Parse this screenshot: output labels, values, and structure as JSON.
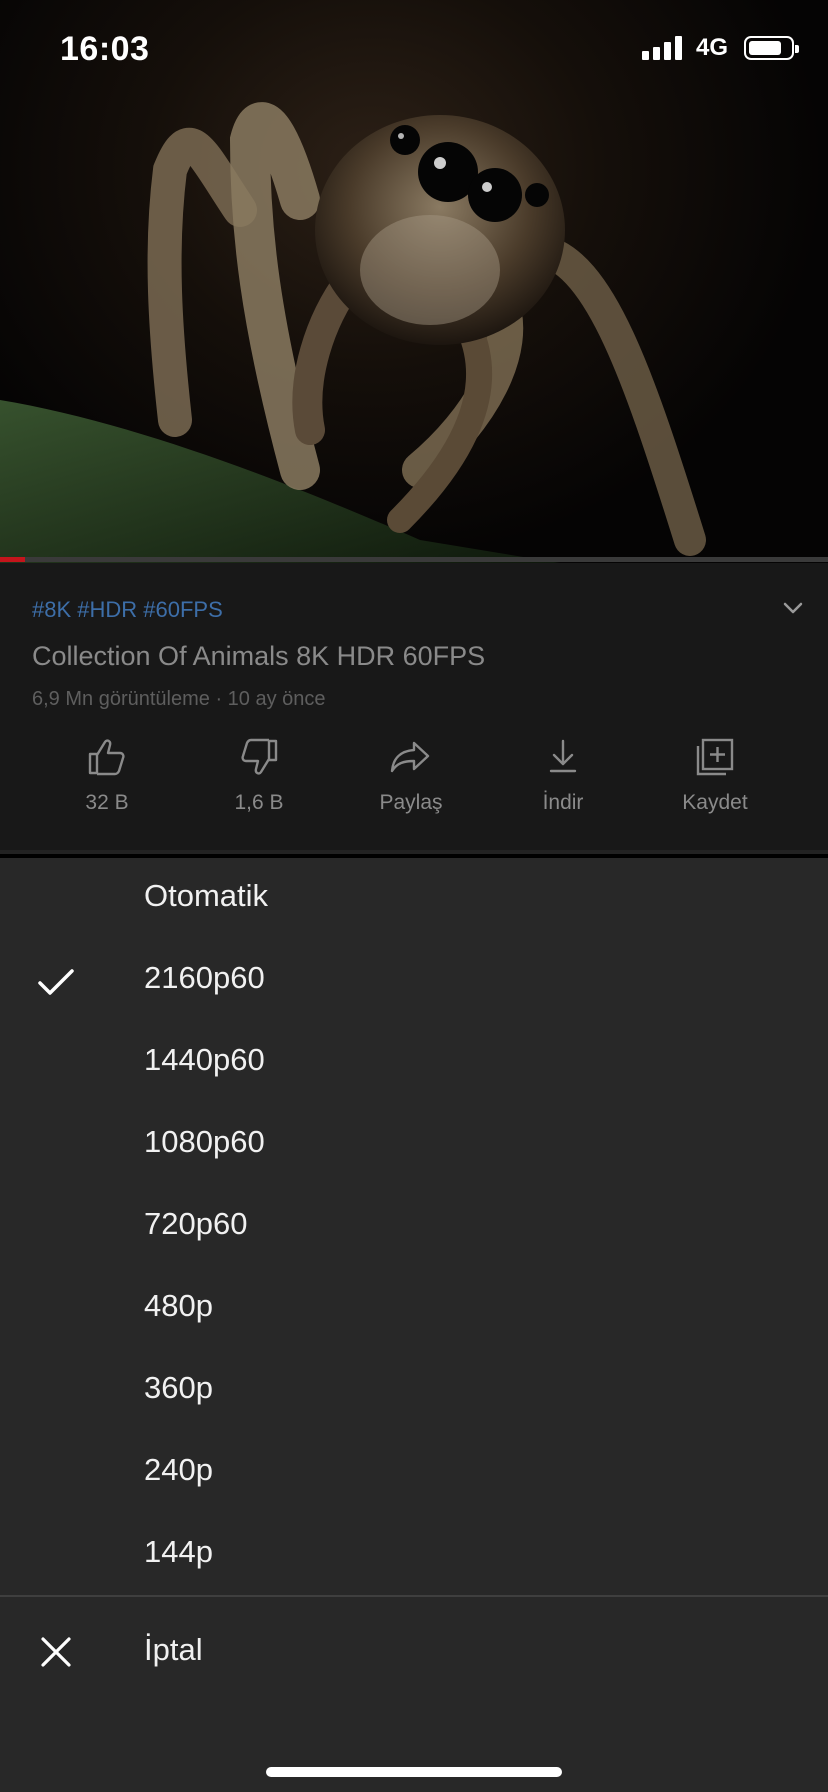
{
  "status_bar": {
    "time": "16:03",
    "network": "4G",
    "battery_level": 0.8
  },
  "video": {
    "thumbnail_subject": "jumping spider on leaf",
    "progress": 0.03
  },
  "info": {
    "hashtags": "#8K #HDR #60FPS",
    "title": "Collection Of Animals 8K HDR 60FPS",
    "meta": "6,9 Mn görüntüleme · 10 ay önce",
    "hashtag_color": "#3d6ea8"
  },
  "actions": [
    {
      "label": "32 B",
      "icon": "thumbs-up-icon"
    },
    {
      "label": "1,6 B",
      "icon": "thumbs-down-icon"
    },
    {
      "label": "Paylaş",
      "icon": "share-icon"
    },
    {
      "label": "İndir",
      "icon": "download-icon"
    },
    {
      "label": "Kaydet",
      "icon": "save-to-playlist-icon"
    }
  ],
  "quality_menu": {
    "options": [
      "Otomatik",
      "2160p60",
      "1440p60",
      "1080p60",
      "720p60",
      "480p",
      "360p",
      "240p",
      "144p"
    ],
    "selected": "2160p60",
    "cancel_label": "İptal"
  }
}
